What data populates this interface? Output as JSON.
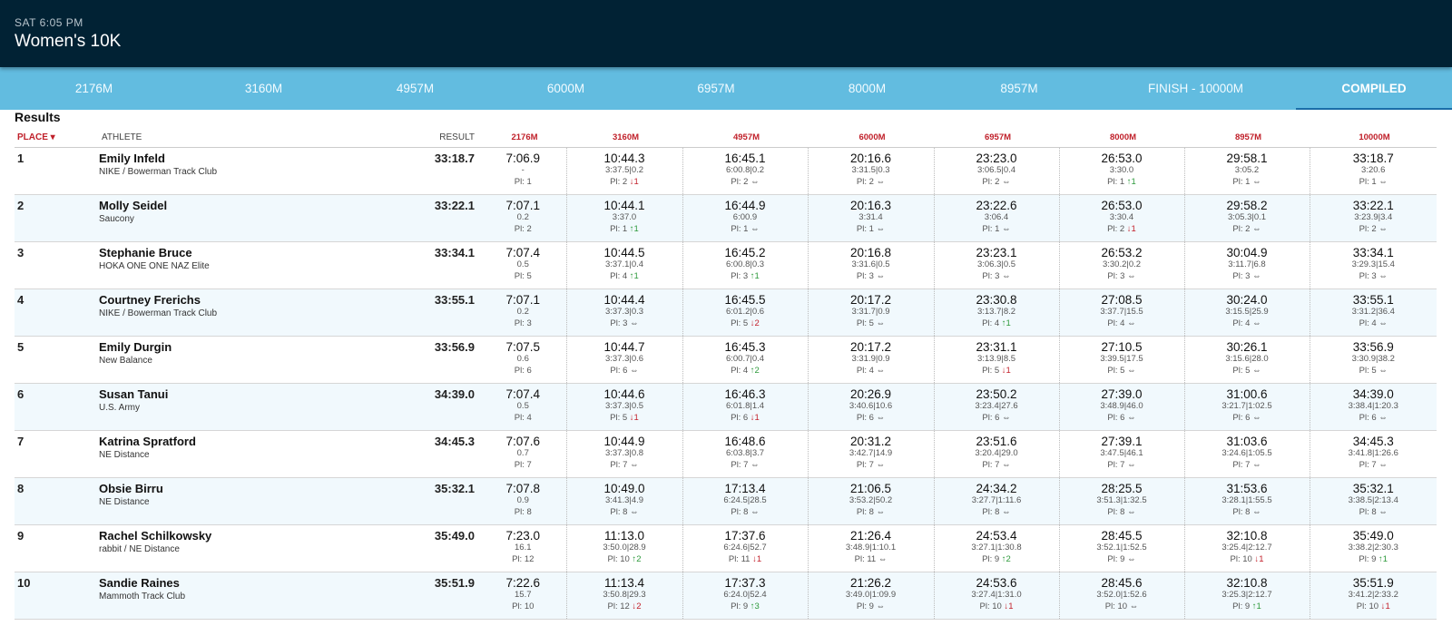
{
  "header": {
    "time": "SAT 6:05 PM",
    "title": "Women's 10K"
  },
  "tabs": [
    {
      "label": "2176M"
    },
    {
      "label": "3160M"
    },
    {
      "label": "4957M"
    },
    {
      "label": "6000M"
    },
    {
      "label": "6957M"
    },
    {
      "label": "8000M"
    },
    {
      "label": "8957M"
    },
    {
      "label": "FINISH - 10000M"
    },
    {
      "label": "COMPILED",
      "active": true
    }
  ],
  "results_title": "Results",
  "columns": {
    "place": "PLACE ▾",
    "athlete": "ATHLETE",
    "result": "RESULT",
    "splits": [
      "2176M",
      "3160M",
      "4957M",
      "6000M",
      "6957M",
      "8000M",
      "8957M",
      "10000M"
    ]
  },
  "indicator_icons": {
    "up": "↑",
    "down": "↓",
    "same": "⇔"
  },
  "colors": {
    "header_bg": "#012234",
    "tab_bg": "#62bce0",
    "accent_red": "#c0202a",
    "up": "#2e9a3c",
    "down": "#c3202b"
  },
  "rows": [
    {
      "place": "1",
      "name": "Emily Infeld",
      "team": "NIKE / Bowerman Track Club",
      "result": "33:18.7",
      "splits": [
        {
          "time": "7:06.9",
          "sub": "-",
          "pl": "Pl: 1",
          "dir": "",
          "delta": ""
        },
        {
          "time": "10:44.3",
          "sub": "3:37.5|0.2",
          "pl": "Pl: 2",
          "dir": "down",
          "delta": "1"
        },
        {
          "time": "16:45.1",
          "sub": "6:00.8|0.2",
          "pl": "Pl: 2",
          "dir": "same",
          "delta": ""
        },
        {
          "time": "20:16.6",
          "sub": "3:31.5|0.3",
          "pl": "Pl: 2",
          "dir": "same",
          "delta": ""
        },
        {
          "time": "23:23.0",
          "sub": "3:06.5|0.4",
          "pl": "Pl: 2",
          "dir": "same",
          "delta": ""
        },
        {
          "time": "26:53.0",
          "sub": "3:30.0",
          "pl": "Pl: 1",
          "dir": "up",
          "delta": "1"
        },
        {
          "time": "29:58.1",
          "sub": "3:05.2",
          "pl": "Pl: 1",
          "dir": "same",
          "delta": ""
        },
        {
          "time": "33:18.7",
          "sub": "3:20.6",
          "pl": "Pl: 1",
          "dir": "same",
          "delta": ""
        }
      ]
    },
    {
      "place": "2",
      "name": "Molly Seidel",
      "team": "Saucony",
      "result": "33:22.1",
      "splits": [
        {
          "time": "7:07.1",
          "sub": "0.2",
          "pl": "Pl: 2",
          "dir": "",
          "delta": ""
        },
        {
          "time": "10:44.1",
          "sub": "3:37.0",
          "pl": "Pl: 1",
          "dir": "up",
          "delta": "1"
        },
        {
          "time": "16:44.9",
          "sub": "6:00.9",
          "pl": "Pl: 1",
          "dir": "same",
          "delta": ""
        },
        {
          "time": "20:16.3",
          "sub": "3:31.4",
          "pl": "Pl: 1",
          "dir": "same",
          "delta": ""
        },
        {
          "time": "23:22.6",
          "sub": "3:06.4",
          "pl": "Pl: 1",
          "dir": "same",
          "delta": ""
        },
        {
          "time": "26:53.0",
          "sub": "3:30.4",
          "pl": "Pl: 2",
          "dir": "down",
          "delta": "1"
        },
        {
          "time": "29:58.2",
          "sub": "3:05.3|0.1",
          "pl": "Pl: 2",
          "dir": "same",
          "delta": ""
        },
        {
          "time": "33:22.1",
          "sub": "3:23.9|3.4",
          "pl": "Pl: 2",
          "dir": "same",
          "delta": ""
        }
      ]
    },
    {
      "place": "3",
      "name": "Stephanie Bruce",
      "team": "HOKA ONE ONE NAZ Elite",
      "result": "33:34.1",
      "splits": [
        {
          "time": "7:07.4",
          "sub": "0.5",
          "pl": "Pl: 5",
          "dir": "",
          "delta": ""
        },
        {
          "time": "10:44.5",
          "sub": "3:37.1|0.4",
          "pl": "Pl: 4",
          "dir": "up",
          "delta": "1"
        },
        {
          "time": "16:45.2",
          "sub": "6:00.8|0.3",
          "pl": "Pl: 3",
          "dir": "up",
          "delta": "1"
        },
        {
          "time": "20:16.8",
          "sub": "3:31.6|0.5",
          "pl": "Pl: 3",
          "dir": "same",
          "delta": ""
        },
        {
          "time": "23:23.1",
          "sub": "3:06.3|0.5",
          "pl": "Pl: 3",
          "dir": "same",
          "delta": ""
        },
        {
          "time": "26:53.2",
          "sub": "3:30.2|0.2",
          "pl": "Pl: 3",
          "dir": "same",
          "delta": ""
        },
        {
          "time": "30:04.9",
          "sub": "3:11.7|6.8",
          "pl": "Pl: 3",
          "dir": "same",
          "delta": ""
        },
        {
          "time": "33:34.1",
          "sub": "3:29.3|15.4",
          "pl": "Pl: 3",
          "dir": "same",
          "delta": ""
        }
      ]
    },
    {
      "place": "4",
      "name": "Courtney Frerichs",
      "team": "NIKE / Bowerman Track Club",
      "result": "33:55.1",
      "splits": [
        {
          "time": "7:07.1",
          "sub": "0.2",
          "pl": "Pl: 3",
          "dir": "",
          "delta": ""
        },
        {
          "time": "10:44.4",
          "sub": "3:37.3|0.3",
          "pl": "Pl: 3",
          "dir": "same",
          "delta": ""
        },
        {
          "time": "16:45.5",
          "sub": "6:01.2|0.6",
          "pl": "Pl: 5",
          "dir": "down",
          "delta": "2"
        },
        {
          "time": "20:17.2",
          "sub": "3:31.7|0.9",
          "pl": "Pl: 5",
          "dir": "same",
          "delta": ""
        },
        {
          "time": "23:30.8",
          "sub": "3:13.7|8.2",
          "pl": "Pl: 4",
          "dir": "up",
          "delta": "1"
        },
        {
          "time": "27:08.5",
          "sub": "3:37.7|15.5",
          "pl": "Pl: 4",
          "dir": "same",
          "delta": ""
        },
        {
          "time": "30:24.0",
          "sub": "3:15.5|25.9",
          "pl": "Pl: 4",
          "dir": "same",
          "delta": ""
        },
        {
          "time": "33:55.1",
          "sub": "3:31.2|36.4",
          "pl": "Pl: 4",
          "dir": "same",
          "delta": ""
        }
      ]
    },
    {
      "place": "5",
      "name": "Emily Durgin",
      "team": "New Balance",
      "result": "33:56.9",
      "splits": [
        {
          "time": "7:07.5",
          "sub": "0.6",
          "pl": "Pl: 6",
          "dir": "",
          "delta": ""
        },
        {
          "time": "10:44.7",
          "sub": "3:37.3|0.6",
          "pl": "Pl: 6",
          "dir": "same",
          "delta": ""
        },
        {
          "time": "16:45.3",
          "sub": "6:00.7|0.4",
          "pl": "Pl: 4",
          "dir": "up",
          "delta": "2"
        },
        {
          "time": "20:17.2",
          "sub": "3:31.9|0.9",
          "pl": "Pl: 4",
          "dir": "same",
          "delta": ""
        },
        {
          "time": "23:31.1",
          "sub": "3:13.9|8.5",
          "pl": "Pl: 5",
          "dir": "down",
          "delta": "1"
        },
        {
          "time": "27:10.5",
          "sub": "3:39.5|17.5",
          "pl": "Pl: 5",
          "dir": "same",
          "delta": ""
        },
        {
          "time": "30:26.1",
          "sub": "3:15.6|28.0",
          "pl": "Pl: 5",
          "dir": "same",
          "delta": ""
        },
        {
          "time": "33:56.9",
          "sub": "3:30.9|38.2",
          "pl": "Pl: 5",
          "dir": "same",
          "delta": ""
        }
      ]
    },
    {
      "place": "6",
      "name": "Susan Tanui",
      "team": "U.S. Army",
      "result": "34:39.0",
      "splits": [
        {
          "time": "7:07.4",
          "sub": "0.5",
          "pl": "Pl: 4",
          "dir": "",
          "delta": ""
        },
        {
          "time": "10:44.6",
          "sub": "3:37.3|0.5",
          "pl": "Pl: 5",
          "dir": "down",
          "delta": "1"
        },
        {
          "time": "16:46.3",
          "sub": "6:01.8|1.4",
          "pl": "Pl: 6",
          "dir": "down",
          "delta": "1"
        },
        {
          "time": "20:26.9",
          "sub": "3:40.6|10.6",
          "pl": "Pl: 6",
          "dir": "same",
          "delta": ""
        },
        {
          "time": "23:50.2",
          "sub": "3:23.4|27.6",
          "pl": "Pl: 6",
          "dir": "same",
          "delta": ""
        },
        {
          "time": "27:39.0",
          "sub": "3:48.9|46.0",
          "pl": "Pl: 6",
          "dir": "same",
          "delta": ""
        },
        {
          "time": "31:00.6",
          "sub": "3:21.7|1:02.5",
          "pl": "Pl: 6",
          "dir": "same",
          "delta": ""
        },
        {
          "time": "34:39.0",
          "sub": "3:38.4|1:20.3",
          "pl": "Pl: 6",
          "dir": "same",
          "delta": ""
        }
      ]
    },
    {
      "place": "7",
      "name": "Katrina Spratford",
      "team": "NE Distance",
      "result": "34:45.3",
      "splits": [
        {
          "time": "7:07.6",
          "sub": "0.7",
          "pl": "Pl: 7",
          "dir": "",
          "delta": ""
        },
        {
          "time": "10:44.9",
          "sub": "3:37.3|0.8",
          "pl": "Pl: 7",
          "dir": "same",
          "delta": ""
        },
        {
          "time": "16:48.6",
          "sub": "6:03.8|3.7",
          "pl": "Pl: 7",
          "dir": "same",
          "delta": ""
        },
        {
          "time": "20:31.2",
          "sub": "3:42.7|14.9",
          "pl": "Pl: 7",
          "dir": "same",
          "delta": ""
        },
        {
          "time": "23:51.6",
          "sub": "3:20.4|29.0",
          "pl": "Pl: 7",
          "dir": "same",
          "delta": ""
        },
        {
          "time": "27:39.1",
          "sub": "3:47.5|46.1",
          "pl": "Pl: 7",
          "dir": "same",
          "delta": ""
        },
        {
          "time": "31:03.6",
          "sub": "3:24.6|1:05.5",
          "pl": "Pl: 7",
          "dir": "same",
          "delta": ""
        },
        {
          "time": "34:45.3",
          "sub": "3:41.8|1:26.6",
          "pl": "Pl: 7",
          "dir": "same",
          "delta": ""
        }
      ]
    },
    {
      "place": "8",
      "name": "Obsie Birru",
      "team": "NE Distance",
      "result": "35:32.1",
      "splits": [
        {
          "time": "7:07.8",
          "sub": "0.9",
          "pl": "Pl: 8",
          "dir": "",
          "delta": ""
        },
        {
          "time": "10:49.0",
          "sub": "3:41.3|4.9",
          "pl": "Pl: 8",
          "dir": "same",
          "delta": ""
        },
        {
          "time": "17:13.4",
          "sub": "6:24.5|28.5",
          "pl": "Pl: 8",
          "dir": "same",
          "delta": ""
        },
        {
          "time": "21:06.5",
          "sub": "3:53.2|50.2",
          "pl": "Pl: 8",
          "dir": "same",
          "delta": ""
        },
        {
          "time": "24:34.2",
          "sub": "3:27.7|1:11.6",
          "pl": "Pl: 8",
          "dir": "same",
          "delta": ""
        },
        {
          "time": "28:25.5",
          "sub": "3:51.3|1:32.5",
          "pl": "Pl: 8",
          "dir": "same",
          "delta": ""
        },
        {
          "time": "31:53.6",
          "sub": "3:28.1|1:55.5",
          "pl": "Pl: 8",
          "dir": "same",
          "delta": ""
        },
        {
          "time": "35:32.1",
          "sub": "3:38.5|2:13.4",
          "pl": "Pl: 8",
          "dir": "same",
          "delta": ""
        }
      ]
    },
    {
      "place": "9",
      "name": "Rachel Schilkowsky",
      "team": "rabbit / NE Distance",
      "result": "35:49.0",
      "splits": [
        {
          "time": "7:23.0",
          "sub": "16.1",
          "pl": "Pl: 12",
          "dir": "",
          "delta": ""
        },
        {
          "time": "11:13.0",
          "sub": "3:50.0|28.9",
          "pl": "Pl: 10",
          "dir": "up",
          "delta": "2"
        },
        {
          "time": "17:37.6",
          "sub": "6:24.6|52.7",
          "pl": "Pl: 11",
          "dir": "down",
          "delta": "1"
        },
        {
          "time": "21:26.4",
          "sub": "3:48.9|1:10.1",
          "pl": "Pl: 11",
          "dir": "same",
          "delta": ""
        },
        {
          "time": "24:53.4",
          "sub": "3:27.1|1:30.8",
          "pl": "Pl: 9",
          "dir": "up",
          "delta": "2"
        },
        {
          "time": "28:45.5",
          "sub": "3:52.1|1:52.5",
          "pl": "Pl: 9",
          "dir": "same",
          "delta": ""
        },
        {
          "time": "32:10.8",
          "sub": "3:25.4|2:12.7",
          "pl": "Pl: 10",
          "dir": "down",
          "delta": "1"
        },
        {
          "time": "35:49.0",
          "sub": "3:38.2|2:30.3",
          "pl": "Pl: 9",
          "dir": "up",
          "delta": "1"
        }
      ]
    },
    {
      "place": "10",
      "name": "Sandie Raines",
      "team": "Mammoth Track Club",
      "result": "35:51.9",
      "splits": [
        {
          "time": "7:22.6",
          "sub": "15.7",
          "pl": "Pl: 10",
          "dir": "",
          "delta": ""
        },
        {
          "time": "11:13.4",
          "sub": "3:50.8|29.3",
          "pl": "Pl: 12",
          "dir": "down",
          "delta": "2"
        },
        {
          "time": "17:37.3",
          "sub": "6:24.0|52.4",
          "pl": "Pl: 9",
          "dir": "up",
          "delta": "3"
        },
        {
          "time": "21:26.2",
          "sub": "3:49.0|1:09.9",
          "pl": "Pl: 9",
          "dir": "same",
          "delta": ""
        },
        {
          "time": "24:53.6",
          "sub": "3:27.4|1:31.0",
          "pl": "Pl: 10",
          "dir": "down",
          "delta": "1"
        },
        {
          "time": "28:45.6",
          "sub": "3:52.0|1:52.6",
          "pl": "Pl: 10",
          "dir": "same",
          "delta": ""
        },
        {
          "time": "32:10.8",
          "sub": "3:25.3|2:12.7",
          "pl": "Pl: 9",
          "dir": "up",
          "delta": "1"
        },
        {
          "time": "35:51.9",
          "sub": "3:41.2|2:33.2",
          "pl": "Pl: 10",
          "dir": "down",
          "delta": "1"
        }
      ]
    }
  ]
}
